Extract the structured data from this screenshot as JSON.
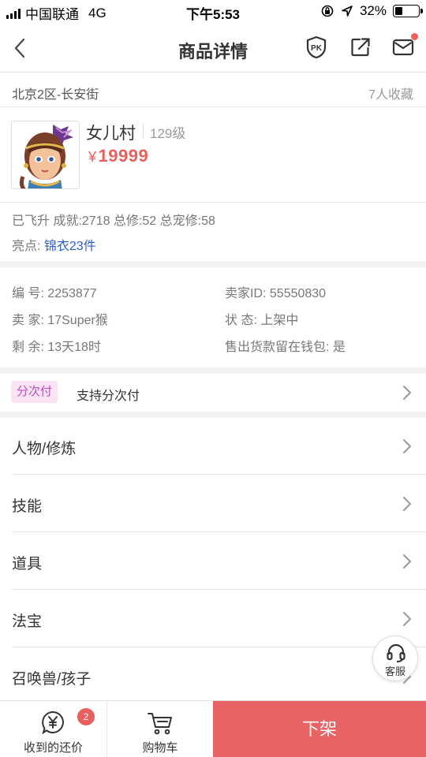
{
  "status_bar": {
    "carrier": "中国联通",
    "network": "4G",
    "time": "下午5:53",
    "battery": "32%",
    "battery_level": 0.32
  },
  "nav": {
    "title": "商品详情",
    "pk_icon_text": "PK",
    "has_message_dot": true
  },
  "location": {
    "server": "北京2区-长安街",
    "favorites": "7人收藏"
  },
  "role": {
    "name": "女儿村",
    "level": "129级",
    "currency": "¥",
    "price": "19999"
  },
  "stats_line": "已飞升 成就:2718 总修:52 总宠修:58",
  "highlight": {
    "label": "亮点: ",
    "value": "锦衣23件"
  },
  "info": {
    "serial": "编 号: 2253877",
    "seller_id": "卖家ID: 55550830",
    "seller": "卖 家: 17Super猴",
    "state": "状 态: 上架中",
    "remaining": "剩 余: 13天18时",
    "wallet": "售出货款留在钱包: 是"
  },
  "installment": {
    "badge": "分次付",
    "text": "支持分次付"
  },
  "menu": [
    {
      "label": "人物/修炼"
    },
    {
      "label": "技能"
    },
    {
      "label": "道具"
    },
    {
      "label": "法宝"
    },
    {
      "label": "召唤兽/孩子"
    }
  ],
  "service": {
    "label": "客服"
  },
  "bottom_bar": {
    "offers_label": "收到的还价",
    "offers_badge": "2",
    "cart_label": "购物车",
    "delist_label": "下架"
  },
  "colors": {
    "price": "#e8605d",
    "link": "#2c5ec9",
    "delist_button": "#e86363",
    "installment_badge_bg": "#fbe3f6",
    "installment_badge_text": "#b554b8"
  }
}
